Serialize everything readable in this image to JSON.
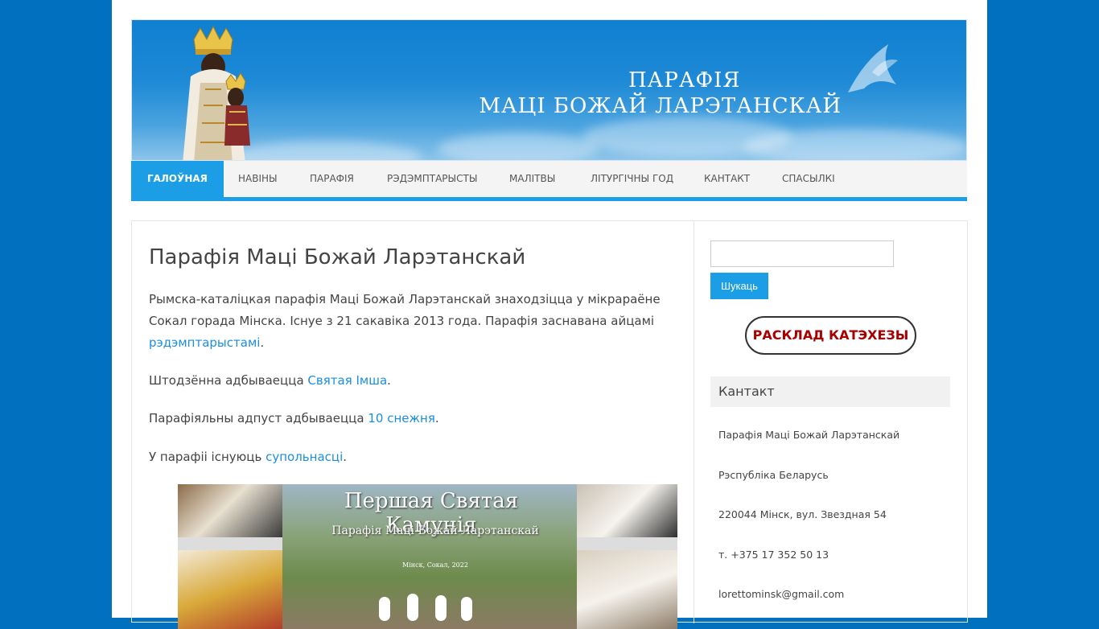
{
  "banner": {
    "title_line1": "ПАРАФІЯ",
    "title_line2": "МАЦІ БОЖАЙ ЛАРЭТАНСКАЙ"
  },
  "nav": {
    "items": [
      {
        "label": "Галоўная",
        "active": true
      },
      {
        "label": "Навіны"
      },
      {
        "label": "Парафія"
      },
      {
        "label": "Рэдэмптарысты"
      },
      {
        "label": "Малітвы"
      },
      {
        "label": "Літургічны год"
      },
      {
        "label": "Кантакт"
      },
      {
        "label": "Спасылкі"
      }
    ]
  },
  "main": {
    "title": "Парафія Маці Божай Ларэтанскай",
    "intro_text": "Рымска-каталіцкая парафія Маці Божай Ларэтанскай знаходзіцца у мікрараёне Сокал горада Мінска. Існуе з 21 сакавіка 2013 года. Парафія заснавана айцамі",
    "intro_link": "рэдэмптарыстамі",
    "mass_text": "Штодзённа адбываецца",
    "mass_link": "Святая Імша",
    "feast_text": "Парафіяльны адпуст адбываецца",
    "feast_link": "10 снежня",
    "communities_text": "У парафіі існуюць",
    "communities_link": "супольнасці",
    "period": ".",
    "collage": {
      "line1": "Першая Святая Камунія",
      "line2": "Парафія Маці Божай Ларэтанскай",
      "line3": "Мінск, Сокал, 2022"
    }
  },
  "sidebar": {
    "search_button": "Шукаць",
    "katechesis_button": "РАСКЛАД КАТЭХЕЗЫ",
    "contact_title": "Кантакт",
    "contact_lines": [
      "Парафія Маці Божай Ларэтанскай",
      "Рэспубліка Беларусь",
      "220044 Мінск, вул. Звездная 54",
      "т. +375 17 352 50 13",
      "lorettominsk@gmail.com"
    ]
  },
  "colors": {
    "background": "#0070bf",
    "accent": "#1b9ee5",
    "link": "#1b8ee0",
    "katechesis_text": "#a80000"
  }
}
